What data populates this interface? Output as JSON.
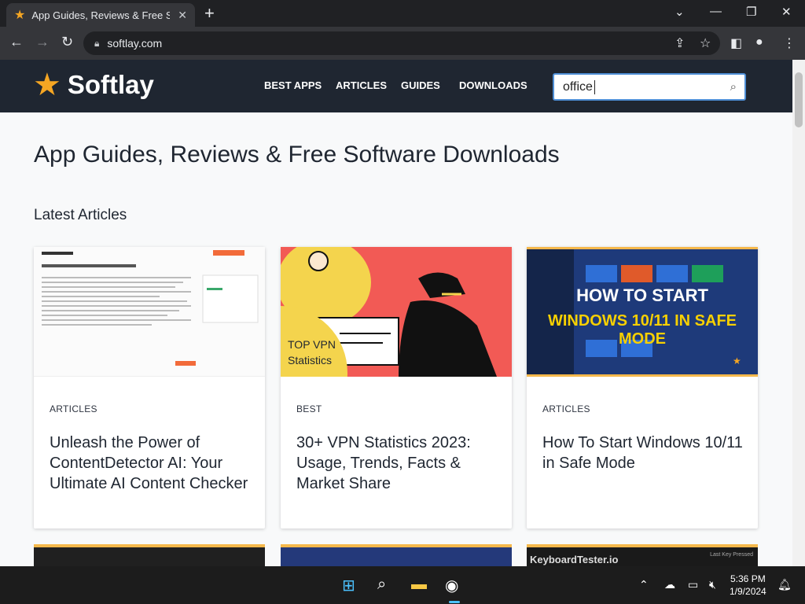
{
  "browser": {
    "tab_title": "App Guides, Reviews & Free Soft",
    "url": "softlay.com",
    "favicon_icon": "star-icon",
    "new_tab_label": "+"
  },
  "site": {
    "logo_text": "Softlay",
    "nav": [
      "BEST APPS",
      "ARTICLES",
      "GUIDES",
      "DOWNLOADS"
    ],
    "search_value": "office",
    "page_title": "App Guides, Reviews & Free Software Downloads",
    "section_title": "Latest Articles"
  },
  "cards": [
    {
      "category": "ARTICLES",
      "title": "Unleash the Power of ContentDetector AI: Your Ultimate AI Content Checker"
    },
    {
      "category": "BEST",
      "title": "30+ VPN Statistics 2023: Usage, Trends, Facts & Market Share",
      "thumb_text": "TOP VPN Statistics"
    },
    {
      "category": "ARTICLES",
      "title": "How To Start Windows 10/11 in Safe Mode",
      "thumb_line1": "HOW TO START",
      "thumb_line2": "WINDOWS 10/11 IN SAFE MODE"
    }
  ],
  "row2": {
    "card3_text": "KeyboardTester.io",
    "card3_small": "Last Key Pressed"
  },
  "taskbar": {
    "time": "5:36 PM",
    "date": "1/9/2024"
  },
  "colors": {
    "header_bg": "#1f2631",
    "accent": "#f5a623",
    "search_border": "#4f8fd6"
  }
}
